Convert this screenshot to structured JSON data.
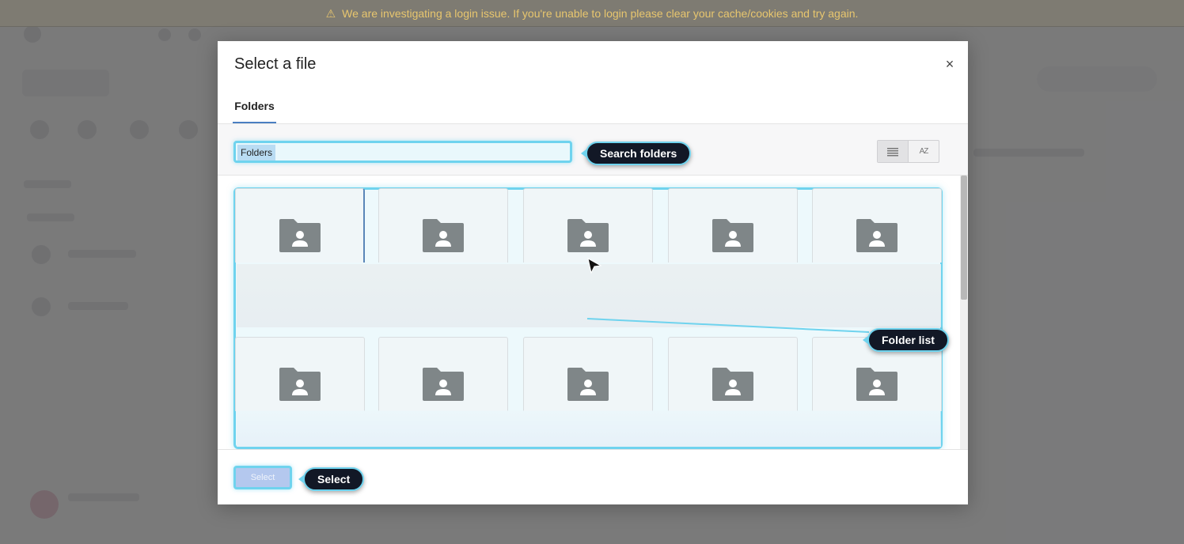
{
  "banner": {
    "icon": "warning-icon",
    "text": "We are investigating a login issue. If you're unable to login please clear your cache/cookies and try again.",
    "color": "#e8c66e"
  },
  "modal": {
    "title": "Select a file",
    "close_icon": "close-icon",
    "tabs": [
      {
        "label": "Folders",
        "active": true
      }
    ],
    "search": {
      "value": "Folders"
    },
    "view_toggle": {
      "list_icon": "list-view-icon",
      "sort_icon": "sort-az-icon",
      "sort_label": "AZ"
    },
    "folders": [
      {
        "icon": "shared-folder-icon"
      },
      {
        "icon": "shared-folder-icon"
      },
      {
        "icon": "shared-folder-icon"
      },
      {
        "icon": "shared-folder-icon"
      },
      {
        "icon": "shared-folder-icon"
      },
      {
        "icon": "shared-folder-icon"
      },
      {
        "icon": "shared-folder-icon"
      },
      {
        "icon": "shared-folder-icon"
      },
      {
        "icon": "shared-folder-icon"
      },
      {
        "icon": "shared-folder-icon"
      }
    ],
    "footer": {
      "select_label": "Select"
    }
  },
  "callouts": {
    "search": "Search folders",
    "folder_list": "Folder list",
    "select": "Select"
  },
  "colors": {
    "highlight": "#6fd3ee",
    "callout_bg": "#121826",
    "tab_accent": "#4a7fc1",
    "folder_icon": "#7f8688"
  }
}
